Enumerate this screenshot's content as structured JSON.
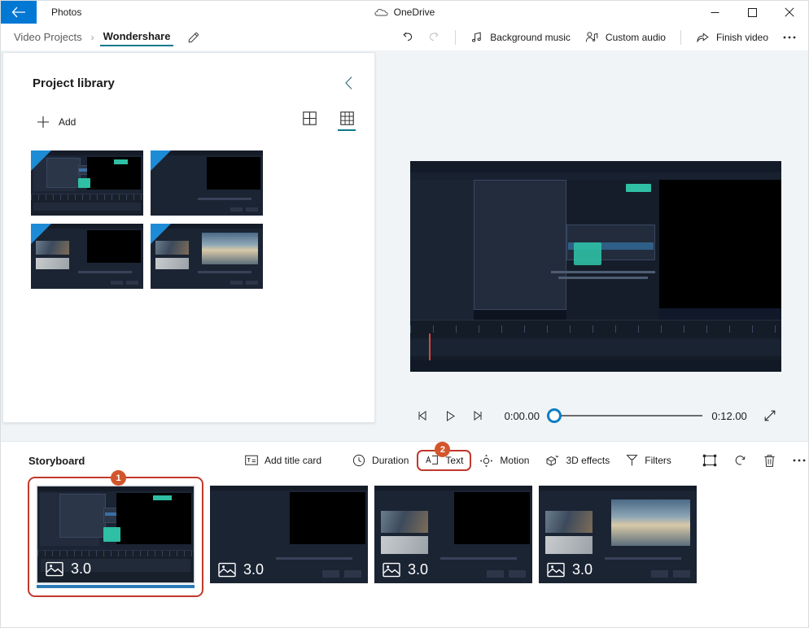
{
  "window": {
    "app_name": "Photos",
    "back_icon": "back-arrow-icon",
    "onedrive_label": "OneDrive",
    "onedrive_icon": "cloud-icon",
    "minimize_icon": "minimize-icon",
    "maximize_icon": "maximize-icon",
    "close_icon": "close-icon",
    "accent_color": "#0078d4"
  },
  "breadcrumb": {
    "parent": "Video Projects",
    "separator": "›",
    "current": "Wondershare",
    "edit_icon": "pencil-icon",
    "active_underline_color": "#0b7a8c"
  },
  "command_bar": {
    "undo_label": "Undo",
    "undo_icon": "undo-icon",
    "redo_label": "Redo",
    "redo_icon": "redo-icon",
    "items": [
      {
        "label": "Background music",
        "icon": "music-note-icon"
      },
      {
        "label": "Custom audio",
        "icon": "person-audio-icon"
      },
      {
        "label": "Finish video",
        "icon": "share-export-icon"
      }
    ],
    "more_label": "···",
    "more_icon": "more-horizontal-icon"
  },
  "library": {
    "title": "Project library",
    "collapse_icon": "chevron-left-icon",
    "add_label": "Add",
    "add_icon": "plus-icon",
    "view_large_icon": "grid-large-icon",
    "view_small_icon": "grid-small-icon",
    "active_view": "grid-small-icon",
    "thumbnails": [
      {
        "name": "library-thumb-1",
        "art": "editor-menu"
      },
      {
        "name": "library-thumb-2",
        "art": "import-dialog"
      },
      {
        "name": "library-thumb-3",
        "art": "import-media-list"
      },
      {
        "name": "library-thumb-4",
        "art": "import-sea-preview"
      }
    ]
  },
  "player": {
    "prev_frame_icon": "previous-frame-icon",
    "play_icon": "play-icon",
    "next_frame_icon": "next-frame-icon",
    "current_time": "0:00.00",
    "total_time": "0:12.00",
    "progress_percent": 0,
    "expand_icon": "expand-fullscreen-icon"
  },
  "storyboard": {
    "title": "Storyboard",
    "tools": [
      {
        "label": "Add title card",
        "icon": "title-card-icon",
        "name": "add-title-card-button",
        "highlighted": false
      },
      {
        "label": "Duration",
        "icon": "clock-icon",
        "name": "duration-button",
        "highlighted": false
      },
      {
        "label": "Text",
        "icon": "text-icon",
        "name": "text-button",
        "highlighted": true,
        "badge": "2"
      },
      {
        "label": "Motion",
        "icon": "motion-icon",
        "name": "motion-button",
        "highlighted": false
      },
      {
        "label": "3D effects",
        "icon": "three-d-effects-icon",
        "name": "3d-effects-button",
        "highlighted": false
      },
      {
        "label": "Filters",
        "icon": "filters-icon",
        "name": "filters-button",
        "highlighted": false
      }
    ],
    "icon_tools": [
      {
        "icon": "crop-resize-icon",
        "name": "crop-button"
      },
      {
        "icon": "rotate-icon",
        "name": "rotate-button"
      },
      {
        "icon": "delete-trash-icon",
        "name": "delete-button"
      },
      {
        "icon": "more-horizontal-icon",
        "name": "storyboard-more-button"
      }
    ],
    "cards": [
      {
        "duration": "3.0",
        "icon": "image-icon",
        "selected": true,
        "badge": "1",
        "art": "editor-menu"
      },
      {
        "duration": "3.0",
        "icon": "image-icon",
        "selected": false,
        "badge": null,
        "art": "import-dialog"
      },
      {
        "duration": "3.0",
        "icon": "image-icon",
        "selected": false,
        "badge": null,
        "art": "import-media-list"
      },
      {
        "duration": "3.0",
        "icon": "image-icon",
        "selected": false,
        "badge": null,
        "art": "import-sea-preview"
      }
    ],
    "badge_color": "#d2562b",
    "highlight_color": "#c0392b"
  }
}
